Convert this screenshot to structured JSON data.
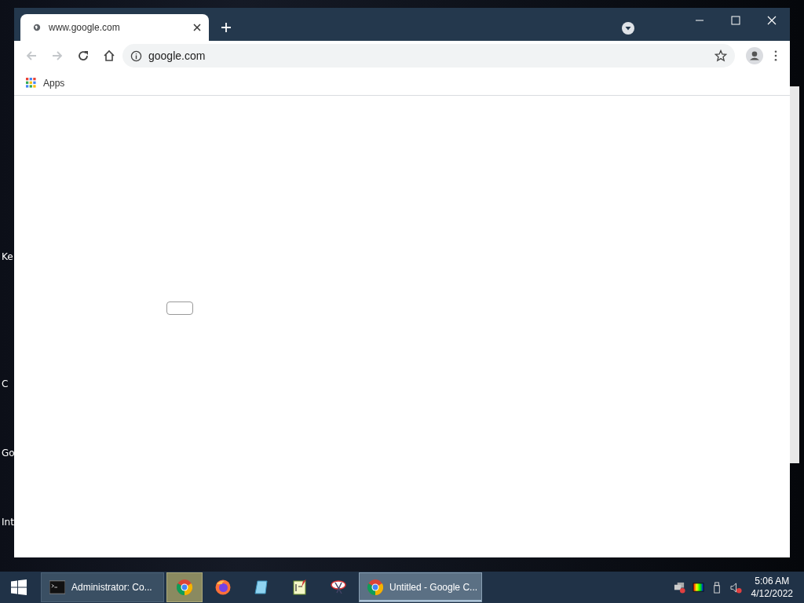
{
  "desktop_icons": [
    {
      "label": "Ke"
    },
    {
      "label": "C"
    },
    {
      "label": "Go"
    },
    {
      "label": "Int"
    }
  ],
  "browser": {
    "tabs": [
      {
        "title": "www.google.com",
        "selected": true
      }
    ],
    "nav_buttons": [
      {
        "kind": "back",
        "disabled": true
      },
      {
        "kind": "forward",
        "disabled": true
      },
      {
        "kind": "reload",
        "disabled": false
      },
      {
        "kind": "home",
        "disabled": false
      }
    ],
    "address": "google.com",
    "bookmarks": [
      {
        "label": "Apps"
      }
    ]
  },
  "taskbar": {
    "items": [
      {
        "kind": "terminal",
        "label": "Administrator: Co...",
        "selected": false,
        "hovered": false
      },
      {
        "kind": "chrome",
        "selected": false,
        "hovered": true
      },
      {
        "kind": "firefox",
        "selected": false,
        "hovered": false
      },
      {
        "kind": "tablet",
        "selected": false,
        "hovered": false
      },
      {
        "kind": "notepad",
        "selected": false,
        "hovered": false
      },
      {
        "kind": "paint",
        "selected": false,
        "hovered": false
      },
      {
        "kind": "chrome",
        "label": "Untitled - Google C...",
        "selected": true,
        "hovered": false
      }
    ],
    "time": "5:06 AM",
    "date": "4/12/2022"
  }
}
